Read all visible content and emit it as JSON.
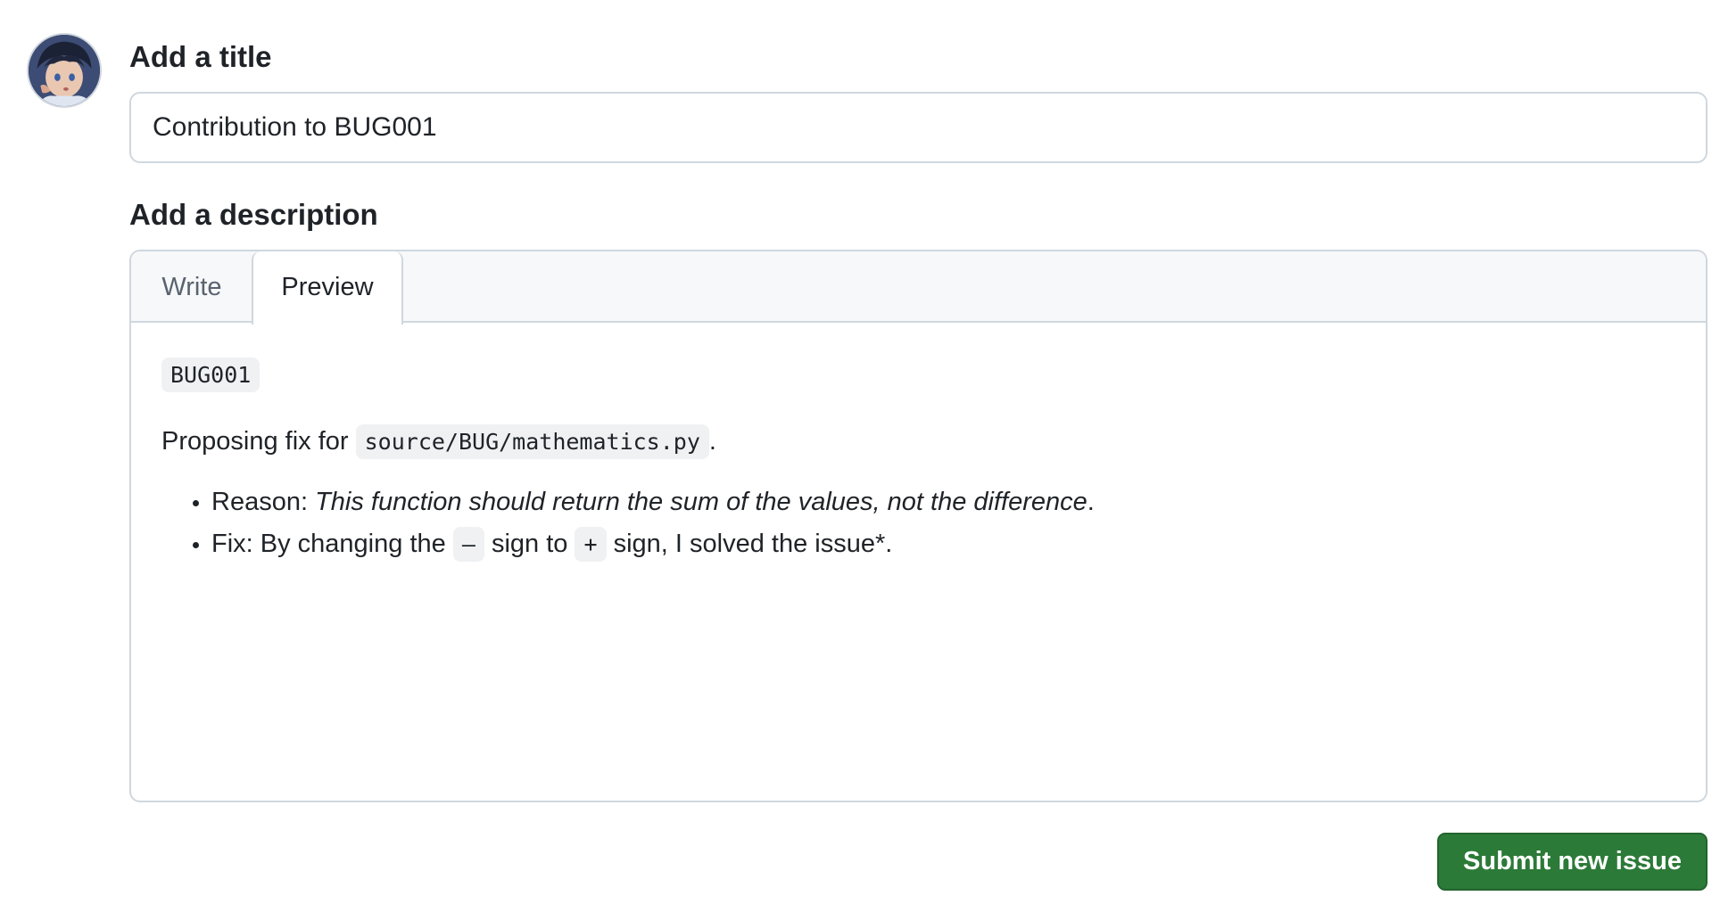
{
  "form": {
    "title_heading": "Add a title",
    "title_value": "Contribution to BUG001",
    "description_heading": "Add a description"
  },
  "editor": {
    "tabs": [
      {
        "label": "Write",
        "active": false
      },
      {
        "label": "Preview",
        "active": true
      }
    ]
  },
  "preview": {
    "code_line": "BUG001",
    "paragraph": {
      "prefix": "Proposing fix for ",
      "code": "source/BUG/mathematics.py",
      "suffix": "."
    },
    "bullets": [
      {
        "label": "Reason: ",
        "italic": "This function should return the sum of the values, not the difference",
        "suffix": "."
      },
      {
        "prefix": "Fix: By changing the ",
        "code_minus": "–",
        "middle": " sign to ",
        "code_plus": "+",
        "suffix": " sign, I solved the issue*."
      }
    ]
  },
  "actions": {
    "submit_label": "Submit new issue"
  },
  "colors": {
    "submit_bg": "#2c7a38",
    "border": "#d0d7de",
    "code_bg": "#eff1f3",
    "tab_bar_bg": "#f6f8fa"
  },
  "icons": {
    "avatar": "user-avatar"
  }
}
